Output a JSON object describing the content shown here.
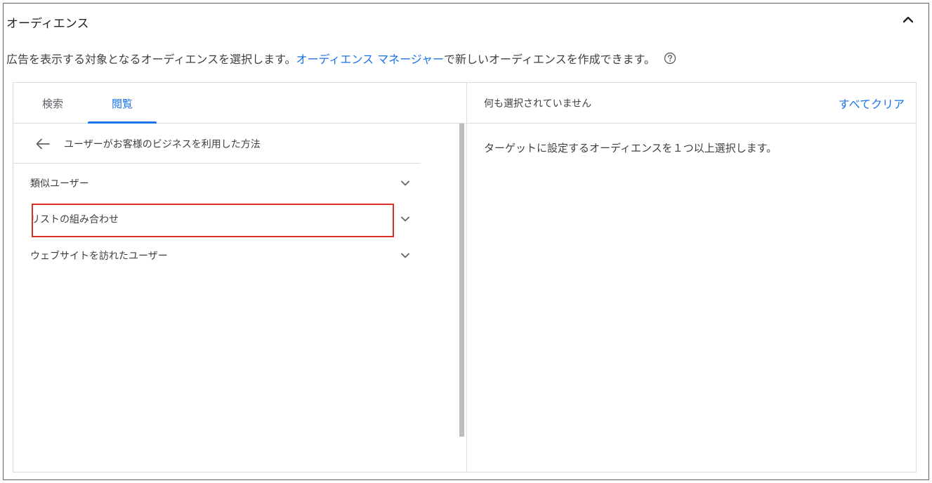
{
  "section": {
    "title": "オーディエンス",
    "collapse_icon": "chevron-up-icon"
  },
  "description": {
    "before": "広告を表示する対象となるオーディエンスを選択します。",
    "link": "オーディエンス マネージャー",
    "after": "で新しいオーディエンスを作成できます。",
    "help_icon": "help-circle-icon"
  },
  "left_panel": {
    "tabs": [
      {
        "label": "検索",
        "active": false
      },
      {
        "label": "閲覧",
        "active": true
      }
    ],
    "breadcrumb": {
      "back_icon": "arrow-left-icon",
      "text": "ユーザーがお客様のビジネスを利用した方法"
    },
    "categories": [
      {
        "label": "類似ユーザー",
        "icon": "chevron-down-icon",
        "highlighted": false
      },
      {
        "label": "リストの組み合わせ",
        "icon": "chevron-down-icon",
        "highlighted": true
      },
      {
        "label": "ウェブサイトを訪れたユーザー",
        "icon": "chevron-down-icon",
        "highlighted": false
      }
    ]
  },
  "right_panel": {
    "status": "何も選択されていません",
    "clear_label": "すべてクリア",
    "hint": "ターゲットに設定するオーディエンスを１つ以上選択します。"
  },
  "colors": {
    "accent": "#1a73e8",
    "highlight": "#d93025",
    "border": "#dadce0",
    "text": "#3c4043"
  }
}
